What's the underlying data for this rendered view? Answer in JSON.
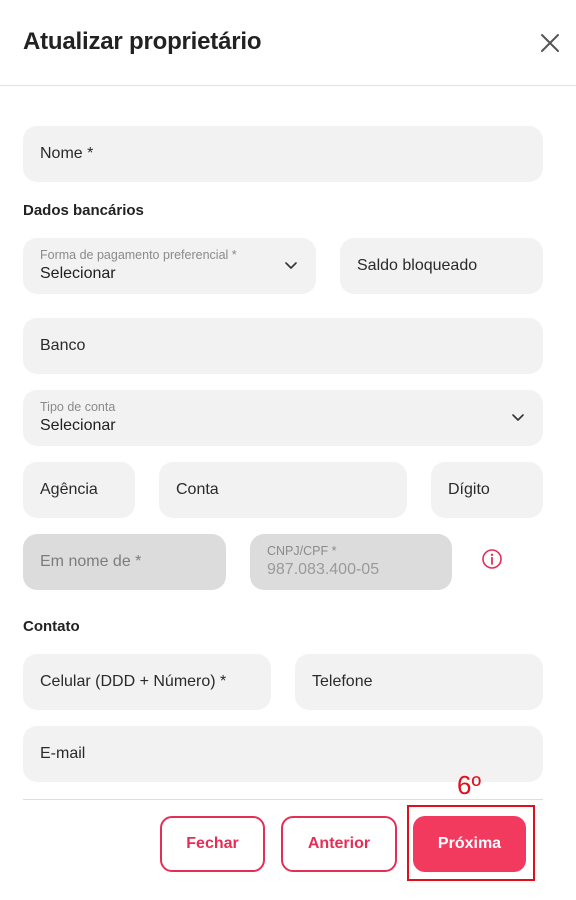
{
  "header": {
    "title": "Atualizar proprietário",
    "close_icon": "close-icon"
  },
  "form": {
    "nome": {
      "label": "Nome *"
    },
    "dados_bancarios": {
      "section_title": "Dados bancários",
      "forma_pagamento": {
        "label": "Forma de pagamento preferencial *",
        "value": "Selecionar"
      },
      "saldo_bloqueado": {
        "label": "Saldo bloqueado"
      },
      "banco": {
        "label": "Banco"
      },
      "tipo_conta": {
        "label": "Tipo de conta",
        "value": "Selecionar"
      },
      "agencia": {
        "label": "Agência"
      },
      "conta": {
        "label": "Conta"
      },
      "digito": {
        "label": "Dígito"
      },
      "em_nome_de": {
        "label": "Em nome de *"
      },
      "cnpj_cpf": {
        "label": "CNPJ/CPF *",
        "value": "987.083.400-05"
      },
      "info_icon": "info-icon"
    },
    "contato": {
      "section_title": "Contato",
      "celular": {
        "label": "Celular (DDD + Número) *"
      },
      "telefone": {
        "label": "Telefone"
      },
      "email": {
        "label": "E-mail"
      }
    }
  },
  "footer": {
    "fechar_label": "Fechar",
    "anterior_label": "Anterior",
    "proxima_label": "Próxima"
  },
  "annotation": {
    "label": "6º",
    "color": "#e0101a"
  },
  "colors": {
    "accent": "#f23a5f",
    "field_bg": "#f2f2f2",
    "disabled_bg": "#dcdcdc"
  }
}
